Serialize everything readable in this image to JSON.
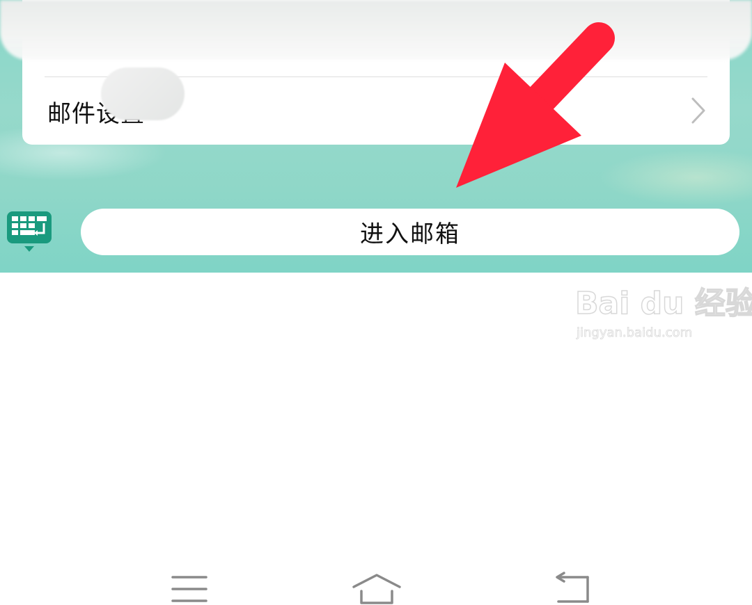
{
  "settings_card": {
    "mail_settings_label": "邮件设置"
  },
  "bottom_bar": {
    "enter_mailbox_label": "进入邮箱",
    "keyboard_icon": "keyboard-icon"
  },
  "annotation": {
    "arrow_color": "#ff2139"
  },
  "system_nav": {
    "menu_icon": "menu-icon",
    "home_icon": "home-icon",
    "back_icon": "back-icon"
  },
  "watermark": {
    "brand": "Bai du 经验",
    "url": "jingyan.baidu.com"
  },
  "colors": {
    "teal_background": "#88d6c8",
    "keyboard_green": "#1a9a7e"
  }
}
